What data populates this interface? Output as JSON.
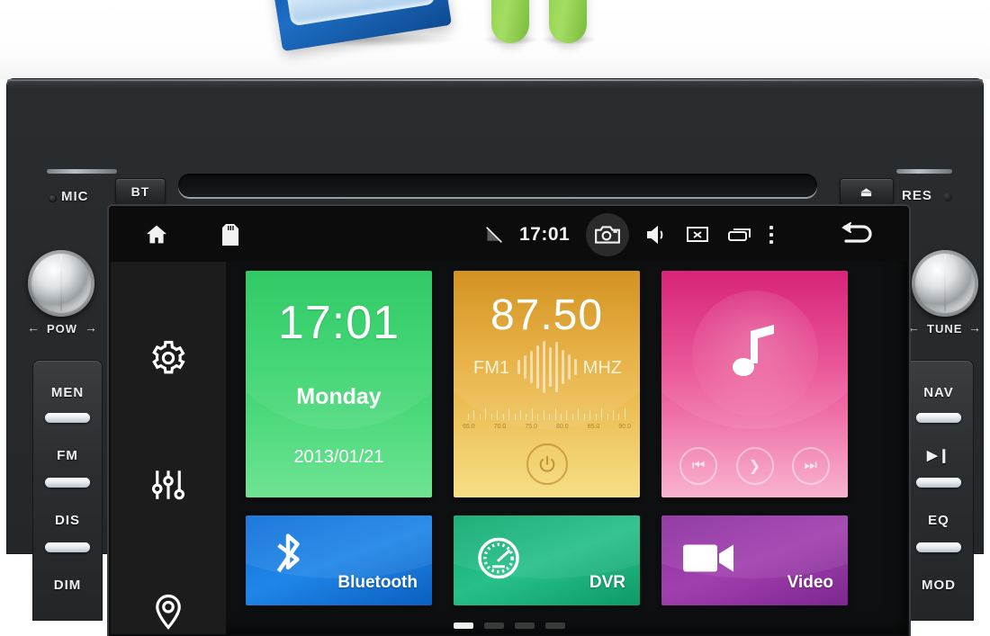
{
  "photo_strip": {
    "watermark": "",
    "items": [
      "blue-product-box",
      "android-robot-legs"
    ]
  },
  "head_unit": {
    "left_bezel": {
      "mic_label": "MIC",
      "bt_button": "BT",
      "pow_caption": "POW",
      "arrow_left": "←",
      "arrow_right": "→",
      "buttons": [
        "MEN",
        "FM",
        "DIS",
        "DIM"
      ]
    },
    "right_bezel": {
      "eject_button": "⏏",
      "res_label": "RES",
      "tune_caption": "TUNE",
      "arrow_left": "←",
      "arrow_right": "→",
      "buttons": [
        "NAV",
        "▶❙",
        "EQ",
        "MOD"
      ]
    }
  },
  "screen": {
    "status_bar": {
      "home_icon": "home-icon",
      "sd_icon": "sd-card-icon",
      "signal_icon": "signal-off-icon",
      "clock": "17:01",
      "camera_icon": "camera-icon",
      "volume_icon": "volume-icon",
      "screen_off_icon": "screen-off-icon",
      "recents_icon": "recent-apps-icon",
      "overflow_icon": "overflow-menu-icon",
      "back_icon": "back-arrow-icon"
    },
    "dock": {
      "items": [
        {
          "name": "settings",
          "icon": "gear-icon"
        },
        {
          "name": "equalizer",
          "icon": "sliders-icon"
        },
        {
          "name": "navigation",
          "icon": "location-pin-icon"
        }
      ]
    },
    "tiles": {
      "clock": {
        "time": "17:01",
        "weekday": "Monday",
        "date": "2013/01/21"
      },
      "radio": {
        "frequency": "87.50",
        "band": "FM1",
        "unit": "MHZ",
        "scale_labels": [
          "65.0",
          "70.0",
          "75.0",
          "80.0",
          "85.0",
          "90.0"
        ],
        "power_icon": "power-icon"
      },
      "music": {
        "icon": "music-note-icon",
        "prev_icon": "⏮",
        "play_icon": "❯",
        "next_icon": "⏭"
      },
      "bluetooth": {
        "label": "Bluetooth",
        "icon": "bluetooth-icon"
      },
      "dvr": {
        "label": "DVR",
        "icon": "gauge-icon"
      },
      "video": {
        "label": "Video",
        "icon": "video-camera-icon"
      }
    },
    "page_indicator": {
      "count": 4,
      "active": 1
    }
  },
  "colors": {
    "tile_clock": "#2ecc63",
    "tile_radio": "#e0a22c",
    "tile_music": "#e2297d",
    "tile_bluetooth": "#1a7fe0",
    "tile_dvr": "#16b07a",
    "tile_video": "#93349f",
    "status_bar_bg": "#0c0c0c",
    "dock_bg": "#1c1c1c"
  }
}
